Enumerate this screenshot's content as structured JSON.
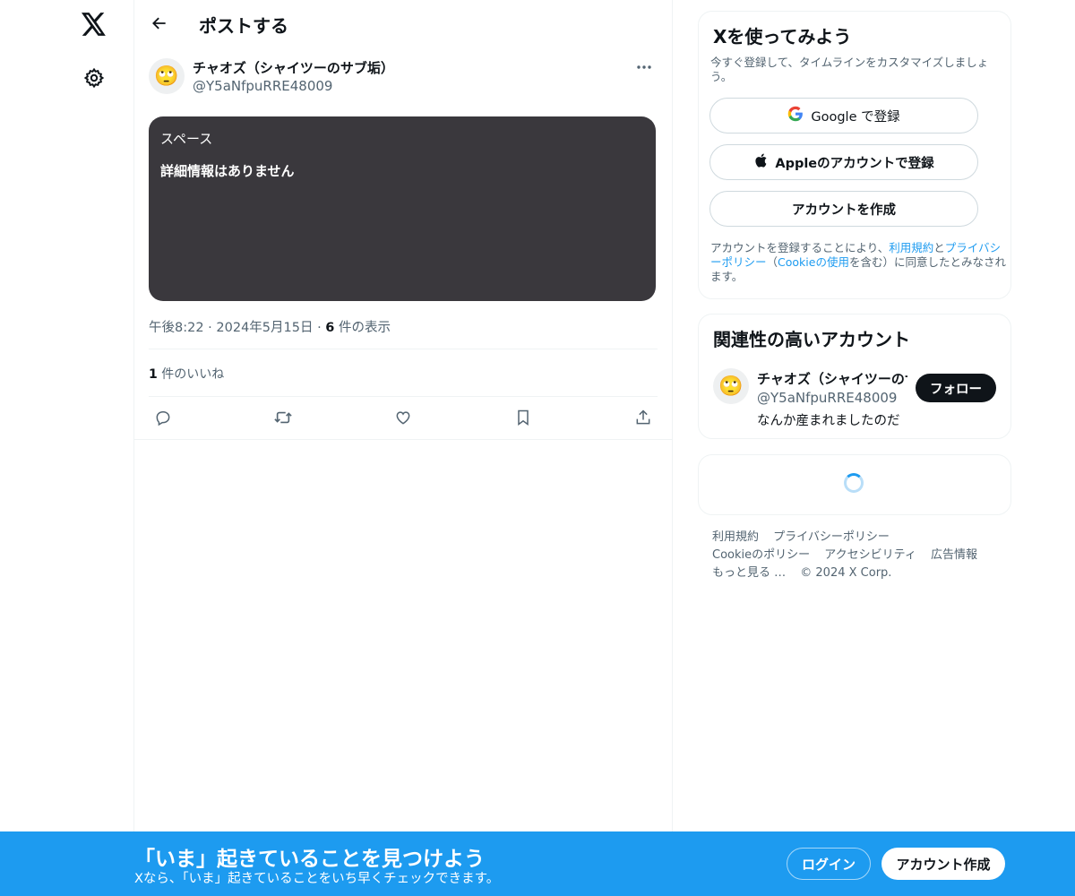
{
  "nav": {
    "logo_icon": "x-logo-icon",
    "settings_icon": "gear-icon"
  },
  "header": {
    "title": "ポストする"
  },
  "post": {
    "author_name": "チャオズ（シャイツーのサブ垢）",
    "author_handle": "@Y5aNfpuRRE48009",
    "avatar_emoji": "🙄",
    "space_label": "スペース",
    "space_detail": "詳細情報はありません",
    "time": "午後8:22",
    "date": "2024年5月15日",
    "views_count": "6",
    "views_label": "件の表示",
    "likes_count": "1",
    "likes_label": "件のいいね"
  },
  "signup": {
    "title": "Xを使ってみよう",
    "subtitle": "今すぐ登録して、タイムラインをカスタマイズしましょう。",
    "google_label": "Google で登録",
    "apple_label": "Appleのアカウントで登録",
    "create_label": "アカウントを作成",
    "terms_prefix": "アカウントを登録することにより、",
    "terms_link": "利用規約",
    "terms_and": "と",
    "privacy_link": "プライバシーポリシー",
    "terms_mid_open": "（",
    "cookie_link": "Cookieの使用",
    "terms_suffix": "を含む）に同意したとみなされます。"
  },
  "related": {
    "title": "関連性の高いアカウント",
    "name": "チャオズ（シャイツーのサブ垢）",
    "handle": "@Y5aNfpuRRE48009",
    "bio": "なんか産まれましたのだ",
    "follow_label": "フォロー",
    "avatar_emoji": "🙄"
  },
  "footer": {
    "links": [
      "利用規約",
      "プライバシーポリシー",
      "Cookieのポリシー",
      "アクセシビリティ",
      "広告情報",
      "もっと見る …"
    ],
    "copyright": "© 2024 X Corp."
  },
  "bottombar": {
    "headline": "「いま」起きていることを見つけよう",
    "subline": "Xなら、「いま」起きていることをいち早くチェックできます。",
    "login_label": "ログイン",
    "create_label": "アカウント作成"
  },
  "colors": {
    "accent": "#1d9bf0",
    "text": "#0f1419",
    "muted": "#536471",
    "space_bg": "#3a383d"
  }
}
